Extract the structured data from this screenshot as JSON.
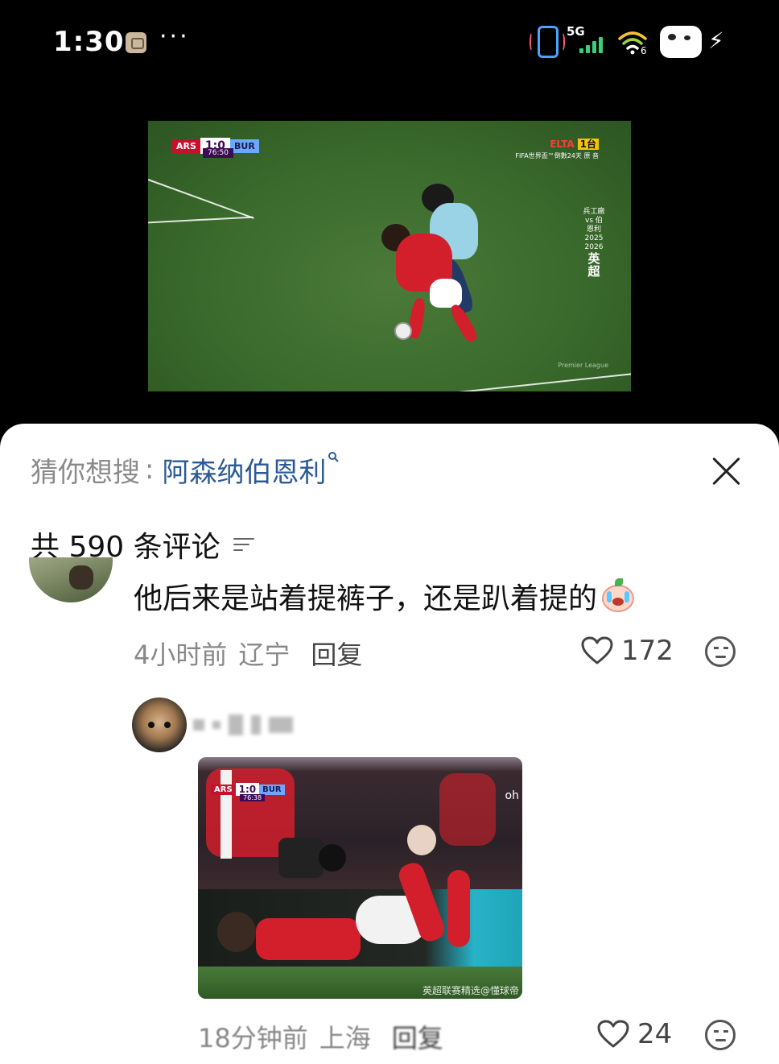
{
  "status_bar": {
    "time": "1:30",
    "more": "···",
    "network": "5G",
    "wifi_badge": "6",
    "icons": [
      "app-icon",
      "phone-signal-icon",
      "cellular-signal-icon",
      "wifi-icon",
      "battery-icon",
      "charging-bolt-icon"
    ]
  },
  "video": {
    "home_team": "ARS",
    "away_team": "BUR",
    "score": "1:0",
    "clock": "76:50",
    "broadcaster": "ELTA",
    "broadcaster_channel": "1台",
    "broadcaster_sub": "FIFA世界盃™倒數24天 原 音",
    "league_small": "兵工廠 vs 伯恩利",
    "league_season": "2025 2026",
    "league_name": "英超",
    "watermark": "Premier League"
  },
  "sheet": {
    "suggest_prefix": "猜你想搜",
    "suggest_colon": ":",
    "suggest_term": "阿森纳伯恩利",
    "comment_count_label": "共 590 条评论"
  },
  "comments": [
    {
      "text": "他后来是站着提裤子，还是趴着提的",
      "time": "4小时前",
      "location": "辽宁",
      "reply_label": "回复",
      "likes": "172"
    },
    {
      "time": "18分钟前",
      "location": "上海",
      "reply_label": "回复",
      "likes": "24",
      "image": {
        "home_team": "ARS",
        "away_team": "BUR",
        "score": "1:0",
        "clock": "76:38",
        "tv_logo": "oh",
        "caption": "英超联赛精选@懂球帝"
      }
    }
  ],
  "colors": {
    "accent_link": "#2b5a96",
    "text_primary": "#111111",
    "text_secondary": "#888888",
    "arsenal_red": "#c8102e",
    "pl_purple": "#3d0a54"
  }
}
